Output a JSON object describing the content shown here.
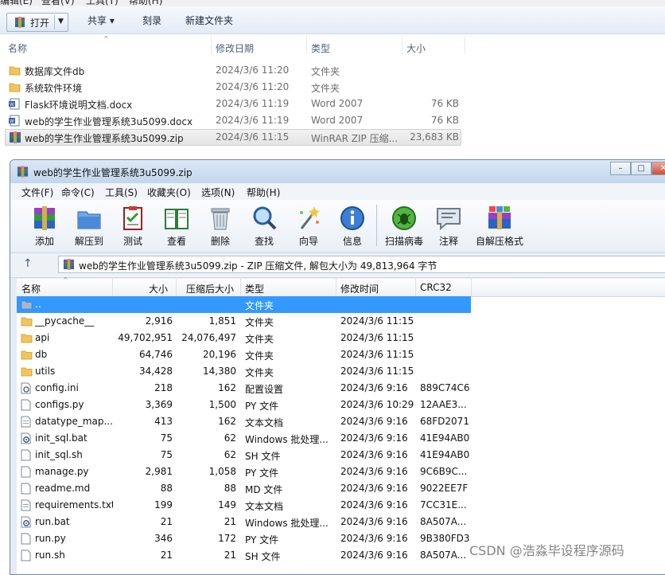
{
  "explorer": {
    "menu": [
      "编辑(E)",
      "查看(V)",
      "工具(T)",
      "帮助(H)"
    ],
    "toolbar": {
      "open_label": "打开",
      "share_label": "共享 ▾",
      "burn_label": "刻录",
      "new_folder_label": "新建文件夹"
    },
    "columns": {
      "name": "名称",
      "modified": "修改日期",
      "type": "类型",
      "size": "大小"
    },
    "files": [
      {
        "name": "数据库文件db",
        "modified": "2024/3/6 11:20",
        "type": "文件夹",
        "size": "",
        "icon": "folder-icon"
      },
      {
        "name": "系统软件环境",
        "modified": "2024/3/6 11:20",
        "type": "文件夹",
        "size": "",
        "icon": "folder-icon"
      },
      {
        "name": "Flask环境说明文档.docx",
        "modified": "2024/3/6 11:19",
        "type": "Word 2007",
        "size": "76 KB",
        "icon": "word-doc-icon"
      },
      {
        "name": "web的学生作业管理系统3u5099.docx",
        "modified": "2024/3/6 11:19",
        "type": "Word 2007",
        "size": "76 KB",
        "icon": "word-doc-icon"
      },
      {
        "name": "web的学生作业管理系统3u5099.zip",
        "modified": "2024/3/6 11:15",
        "type": "WinRAR ZIP 压缩...",
        "size": "23,683 KB",
        "icon": "winrar-archive-icon"
      }
    ]
  },
  "winrar": {
    "title": "web的学生作业管理系统3u5099.zip",
    "menu": [
      "文件(F)",
      "命令(C)",
      "工具(S)",
      "收藏夹(O)",
      "选项(N)",
      "帮助(H)"
    ],
    "tools": [
      "添加",
      "解压到",
      "测试",
      "查看",
      "删除",
      "查找",
      "向导",
      "信息",
      "扫描病毒",
      "注释",
      "自解压格式"
    ],
    "path": "web的学生作业管理系统3u5099.zip - ZIP 压缩文件, 解包大小为 49,813,964 字节",
    "columns": {
      "name": "名称",
      "size": "大小",
      "packed": "压缩后大小",
      "type": "类型",
      "modified": "修改时间",
      "crc": "CRC32"
    },
    "files": [
      {
        "name": "..",
        "size": "",
        "packed": "",
        "type": "文件夹",
        "modified": "",
        "crc": "",
        "icon": "folder-up-icon"
      },
      {
        "name": "__pycache__",
        "size": "2,916",
        "packed": "1,851",
        "type": "文件夹",
        "modified": "2024/3/6 11:15",
        "crc": "",
        "icon": "folder-icon"
      },
      {
        "name": "api",
        "size": "49,702,951",
        "packed": "24,076,497",
        "type": "文件夹",
        "modified": "2024/3/6 11:15",
        "crc": "",
        "icon": "folder-icon"
      },
      {
        "name": "db",
        "size": "64,746",
        "packed": "20,196",
        "type": "文件夹",
        "modified": "2024/3/6 11:15",
        "crc": "",
        "icon": "folder-icon"
      },
      {
        "name": "utils",
        "size": "34,428",
        "packed": "14,380",
        "type": "文件夹",
        "modified": "2024/3/6 11:15",
        "crc": "",
        "icon": "folder-icon"
      },
      {
        "name": "config.ini",
        "size": "218",
        "packed": "162",
        "type": "配置设置",
        "modified": "2024/3/6 9:16",
        "crc": "889C74C6",
        "icon": "config-file-icon"
      },
      {
        "name": "configs.py",
        "size": "3,369",
        "packed": "1,500",
        "type": "PY 文件",
        "modified": "2024/3/6 10:29",
        "crc": "12AAE3...",
        "icon": "file-icon"
      },
      {
        "name": "datatype_map....",
        "size": "413",
        "packed": "162",
        "type": "文本文档",
        "modified": "2024/3/6 9:16",
        "crc": "68FD2071",
        "icon": "text-file-icon"
      },
      {
        "name": "init_sql.bat",
        "size": "75",
        "packed": "62",
        "type": "Windows 批处理...",
        "modified": "2024/3/6 9:16",
        "crc": "41E94AB0",
        "icon": "batch-file-icon"
      },
      {
        "name": "init_sql.sh",
        "size": "75",
        "packed": "62",
        "type": "SH 文件",
        "modified": "2024/3/6 9:16",
        "crc": "41E94AB0",
        "icon": "file-icon"
      },
      {
        "name": "manage.py",
        "size": "2,981",
        "packed": "1,058",
        "type": "PY 文件",
        "modified": "2024/3/6 9:16",
        "crc": "9C6B9C...",
        "icon": "file-icon"
      },
      {
        "name": "readme.md",
        "size": "88",
        "packed": "88",
        "type": "MD 文件",
        "modified": "2024/3/6 9:16",
        "crc": "9022EE7F",
        "icon": "file-icon"
      },
      {
        "name": "requirements.txt",
        "size": "199",
        "packed": "149",
        "type": "文本文档",
        "modified": "2024/3/6 9:16",
        "crc": "7CC31E...",
        "icon": "text-file-icon"
      },
      {
        "name": "run.bat",
        "size": "21",
        "packed": "21",
        "type": "Windows 批处理...",
        "modified": "2024/3/6 9:16",
        "crc": "8A507A...",
        "icon": "batch-file-icon"
      },
      {
        "name": "run.py",
        "size": "346",
        "packed": "172",
        "type": "PY 文件",
        "modified": "2024/3/6 9:16",
        "crc": "9B380FD3",
        "icon": "file-icon"
      },
      {
        "name": "run.sh",
        "size": "21",
        "packed": "21",
        "type": "SH 文件",
        "modified": "2024/3/6 9:16",
        "crc": "8A507A...",
        "icon": "file-icon"
      }
    ]
  },
  "watermark": "CSDN @浩淼毕设程序源码",
  "colors": {
    "selection": "#3399ff",
    "folder": "#f2c55c",
    "accent": "#1e4f8a"
  }
}
